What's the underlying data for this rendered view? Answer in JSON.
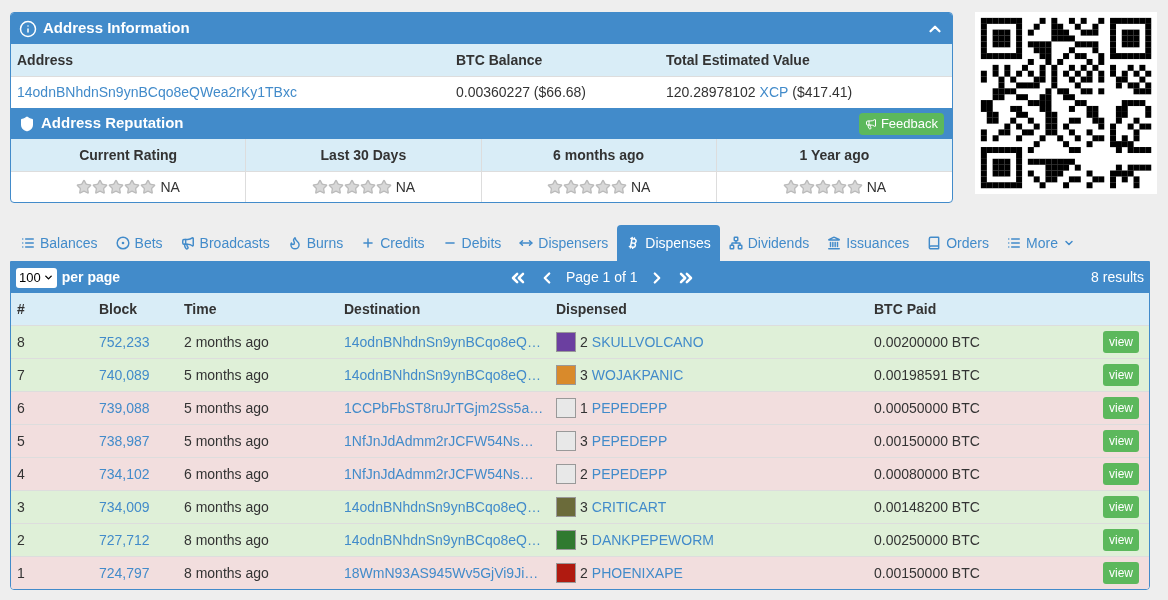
{
  "address_info": {
    "title": "Address Information",
    "columns": [
      "Address",
      "BTC Balance",
      "Total Estimated Value"
    ],
    "address": "14odnBNhdnSn9ynBCqo8eQWea2rKy1TBxc",
    "btc_balance": "0.00360227 ($66.68)",
    "total_value": {
      "amount": "120.28978102",
      "asset": "XCP",
      "usd": "($417.41)"
    }
  },
  "reputation": {
    "title": "Address Reputation",
    "feedback_button": "Feedback",
    "ratings": [
      {
        "label": "Current Rating",
        "stars": 0,
        "value": "NA"
      },
      {
        "label": "Last 30 Days",
        "stars": 0,
        "value": "NA"
      },
      {
        "label": "6 months ago",
        "stars": 0,
        "value": "NA"
      },
      {
        "label": "1 Year ago",
        "stars": 0,
        "value": "NA"
      }
    ]
  },
  "tabs": [
    {
      "label": "Balances",
      "selected": false
    },
    {
      "label": "Bets",
      "selected": false
    },
    {
      "label": "Broadcasts",
      "selected": false
    },
    {
      "label": "Burns",
      "selected": false
    },
    {
      "label": "Credits",
      "selected": false
    },
    {
      "label": "Debits",
      "selected": false
    },
    {
      "label": "Dispensers",
      "selected": false
    },
    {
      "label": "Dispenses",
      "selected": true
    },
    {
      "label": "Dividends",
      "selected": false
    },
    {
      "label": "Issuances",
      "selected": false
    },
    {
      "label": "Orders",
      "selected": false
    },
    {
      "label": "More",
      "selected": false
    }
  ],
  "table": {
    "per_page": "100",
    "per_page_label": "per page",
    "page": "Page 1 of 1",
    "results": "8 results",
    "columns": [
      "#",
      "Block",
      "Time",
      "Destination",
      "Dispensed",
      "BTC Paid"
    ],
    "rows": [
      {
        "color": "#dff0d8",
        "n": "8",
        "block": "752,233",
        "time": "2 months ago",
        "destination": "14odnBNhdnSn9ynBCqo8eQ…",
        "qty": "2",
        "asset": "SKULLVOLCANO",
        "btc": "0.00200000 BTC",
        "button": "view"
      },
      {
        "color": "#dff0d8",
        "n": "7",
        "block": "740,089",
        "time": "5 months ago",
        "destination": "14odnBNhdnSn9ynBCqo8eQ…",
        "qty": "3",
        "asset": "WOJAKPANIC",
        "btc": "0.00198591 BTC",
        "button": "view"
      },
      {
        "color": "#f2dede",
        "n": "6",
        "block": "739,088",
        "time": "5 months ago",
        "destination": "1CCPbFbST8ruJrTGjm2Ss5a…",
        "qty": "1",
        "asset": "PEPEDEPP",
        "btc": "0.00050000 BTC",
        "button": "view"
      },
      {
        "color": "#f2dede",
        "n": "5",
        "block": "738,987",
        "time": "5 months ago",
        "destination": "1NfJnJdAdmm2rJCFW54Ns…",
        "qty": "3",
        "asset": "PEPEDEPP",
        "btc": "0.00150000 BTC",
        "button": "view"
      },
      {
        "color": "#f2dede",
        "n": "4",
        "block": "734,102",
        "time": "6 months ago",
        "destination": "1NfJnJdAdmm2rJCFW54Ns…",
        "qty": "2",
        "asset": "PEPEDEPP",
        "btc": "0.00080000 BTC",
        "button": "view"
      },
      {
        "color": "#dff0d8",
        "n": "3",
        "block": "734,009",
        "time": "6 months ago",
        "destination": "14odnBNhdnSn9ynBCqo8eQ…",
        "qty": "3",
        "asset": "CRITICART",
        "btc": "0.00148200 BTC",
        "button": "view"
      },
      {
        "color": "#dff0d8",
        "n": "2",
        "block": "727,712",
        "time": "8 months ago",
        "destination": "14odnBNhdnSn9ynBCqo8eQ…",
        "qty": "5",
        "asset": "DANKPEPEWORM",
        "btc": "0.00250000 BTC",
        "button": "view"
      },
      {
        "color": "#f2dede",
        "n": "1",
        "block": "724,797",
        "time": "8 months ago",
        "destination": "18WmN93AS945Wv5GjVi9Ji…",
        "qty": "2",
        "asset": "PHOENIXAPE",
        "btc": "0.00150000 BTC",
        "button": "view"
      }
    ]
  }
}
